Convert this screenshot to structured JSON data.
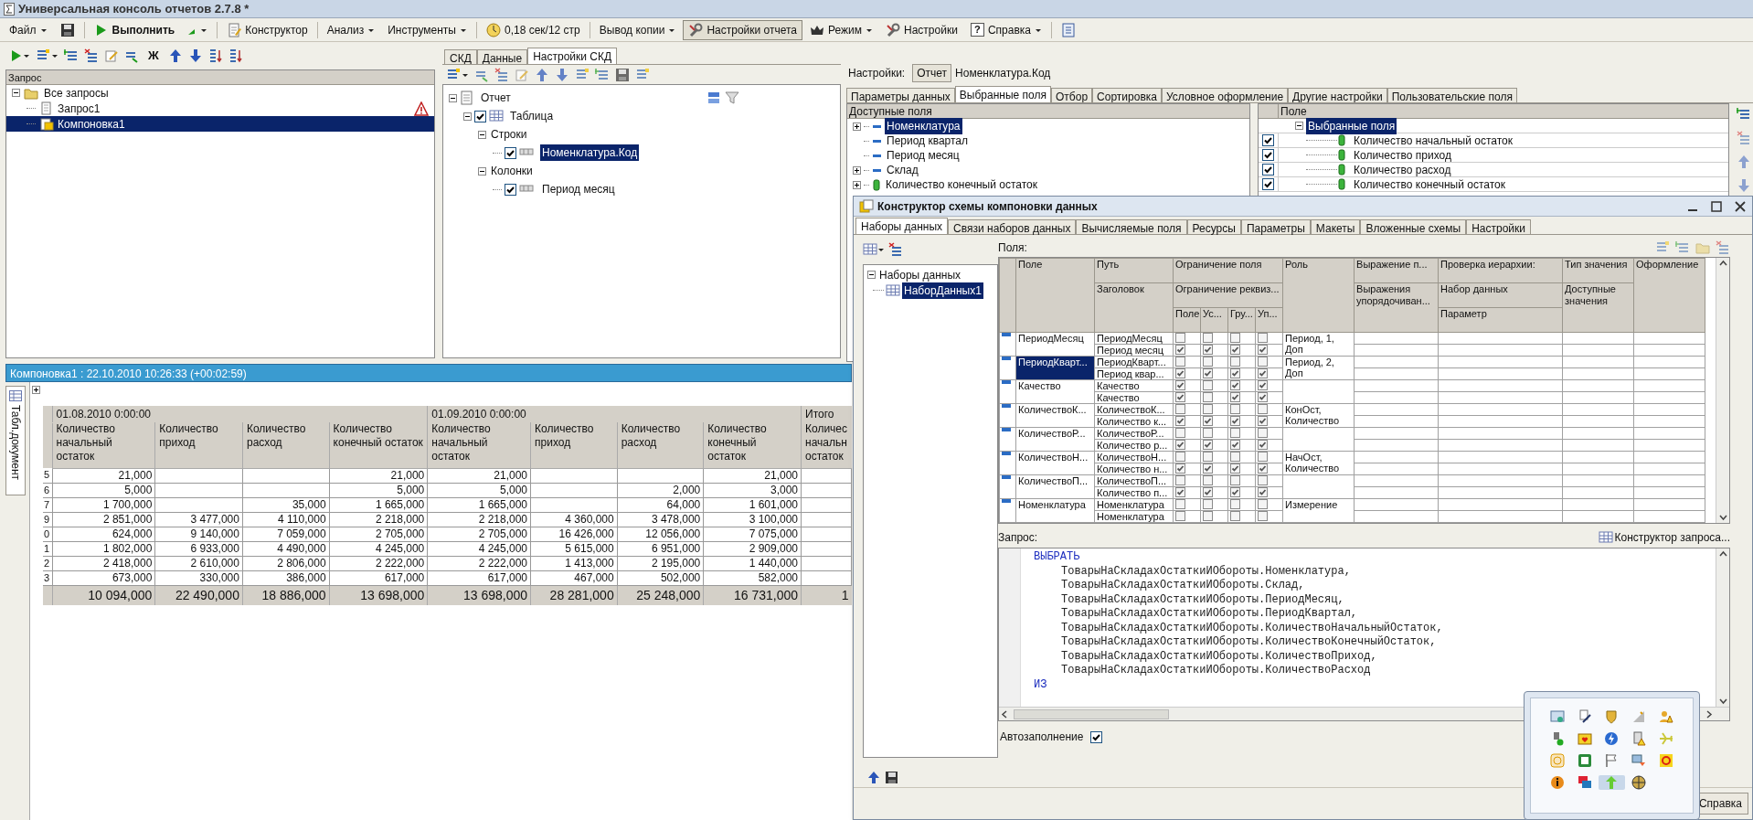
{
  "window": {
    "title": "Универсальная консоль отчетов 2.7.8 *"
  },
  "toolbar": [
    {
      "kind": "menu",
      "label": "Файл",
      "pressed": false
    },
    {
      "kind": "save",
      "pressed": false
    },
    {
      "kind": "run",
      "label": "Выполнить",
      "pressed": false
    },
    {
      "kind": "run_menu",
      "pressed": false
    },
    {
      "kind": "designer",
      "label": "Конструктор",
      "pressed": false
    },
    {
      "kind": "menu",
      "label": "Анализ",
      "pressed": false
    },
    {
      "kind": "menu",
      "label": "Инструменты",
      "pressed": false
    },
    {
      "kind": "timer",
      "label": "0,18 сек/12 стр",
      "pressed": false
    },
    {
      "kind": "menu",
      "label": "Вывод копии",
      "pressed": false
    },
    {
      "kind": "tools",
      "label": "Настройки отчета",
      "pressed": true
    },
    {
      "kind": "mode",
      "label": "Режим",
      "pressed": false
    },
    {
      "kind": "tools",
      "label": "Настройки",
      "pressed": false
    },
    {
      "kind": "help_menu",
      "glyph": "?",
      "label": "Справка",
      "pressed": false
    },
    {
      "kind": "help",
      "pressed": false
    }
  ],
  "query_panel": {
    "bold_button": "Ж",
    "header": "Запрос",
    "tree": [
      {
        "label": "Все запросы",
        "kind": "folder",
        "selected": false,
        "warning": false,
        "children": [
          {
            "label": "Запрос1",
            "kind": "query",
            "selected": false,
            "warning": true
          },
          {
            "label": "Компоновка1",
            "kind": "composition",
            "selected": true,
            "warning": false
          }
        ]
      }
    ]
  },
  "skd_panel": {
    "tabs": [
      {
        "label": "СКД",
        "selected": false
      },
      {
        "label": "Данные",
        "selected": false
      },
      {
        "label": "Настройки СКД",
        "selected": true
      }
    ],
    "tree": [
      {
        "label": "Отчет",
        "kind": "report",
        "selected": false,
        "children": [
          {
            "label": "Таблица",
            "kind": "table",
            "checked": true,
            "selected": false,
            "children": [
              {
                "label": "Строки",
                "kind": "group",
                "selected": false,
                "children": [
                  {
                    "label": "Номенклатура.Код",
                    "kind": "field",
                    "checked": true,
                    "selected": true
                  }
                ]
              },
              {
                "label": "Колонки",
                "kind": "group",
                "selected": false,
                "children": [
                  {
                    "label": "Период месяц",
                    "kind": "field",
                    "checked": true,
                    "selected": false
                  }
                ]
              }
            ]
          }
        ]
      }
    ]
  },
  "settings": {
    "label": "Настройки:",
    "button": "Отчет",
    "current": "Номенклатура.Код",
    "tabs": [
      {
        "label": "Параметры данных",
        "selected": false
      },
      {
        "label": "Выбранные поля",
        "selected": true
      },
      {
        "label": "Отбор",
        "selected": false
      },
      {
        "label": "Сортировка",
        "selected": false
      },
      {
        "label": "Условное оформление",
        "selected": false
      },
      {
        "label": "Другие настройки",
        "selected": false
      },
      {
        "label": "Пользовательские поля",
        "selected": false
      }
    ],
    "available": {
      "header": "Доступные поля",
      "items": [
        {
          "label": "Номенклатура",
          "kind": "dimension",
          "expandable": true,
          "selected": true
        },
        {
          "label": "Период квартал",
          "kind": "dimension",
          "expandable": false,
          "selected": false
        },
        {
          "label": "Период месяц",
          "kind": "dimension",
          "expandable": false,
          "selected": false
        },
        {
          "label": "Склад",
          "kind": "dimension",
          "expandable": true,
          "selected": false
        },
        {
          "label": "Количество конечный остаток",
          "kind": "resource",
          "expandable": true,
          "selected": false
        }
      ]
    },
    "chosen": {
      "header": "Поле",
      "root": "Выбранные поля",
      "items": [
        {
          "label": "Количество начальный остаток",
          "checked": true
        },
        {
          "label": "Количество приход",
          "checked": true
        },
        {
          "label": "Количество расход",
          "checked": true
        },
        {
          "label": "Количество конечный остаток",
          "checked": true
        }
      ]
    }
  },
  "report": {
    "title": "Компоновка1 : 22.10.2010 10:26:33 (+00:02:59)",
    "side_tab": "Табл.документ",
    "groups": [
      {
        "label": "01.08.2010 0:00:00",
        "columns": [
          "Количество начальный остаток",
          "Количество приход",
          "Количество расход",
          "Количество конечный остаток"
        ]
      },
      {
        "label": "01.09.2010 0:00:00",
        "columns": [
          "Количество начальный остаток",
          "Количество приход",
          "Количество расход",
          "Количество конечный остаток"
        ]
      },
      {
        "label": "Итого",
        "columns": [
          "Количес начальн остаток"
        ]
      }
    ],
    "rows": [
      {
        "key": "5",
        "cells": [
          "21,000",
          null,
          null,
          "21,000",
          "21,000",
          null,
          null,
          "21,000",
          null
        ]
      },
      {
        "key": "6",
        "cells": [
          "5,000",
          null,
          null,
          "5,000",
          "5,000",
          null,
          "2,000",
          "3,000",
          null
        ]
      },
      {
        "key": "7",
        "cells": [
          "1 700,000",
          null,
          "35,000",
          "1 665,000",
          "1 665,000",
          null,
          "64,000",
          "1 601,000",
          null
        ]
      },
      {
        "key": "9",
        "cells": [
          "2 851,000",
          "3 477,000",
          "4 110,000",
          "2 218,000",
          "2 218,000",
          "4 360,000",
          "3 478,000",
          "3 100,000",
          null
        ]
      },
      {
        "key": "0",
        "cells": [
          "624,000",
          "9 140,000",
          "7 059,000",
          "2 705,000",
          "2 705,000",
          "16 426,000",
          "12 056,000",
          "7 075,000",
          null
        ]
      },
      {
        "key": "1",
        "cells": [
          "1 802,000",
          "6 933,000",
          "4 490,000",
          "4 245,000",
          "4 245,000",
          "5 615,000",
          "6 951,000",
          "2 909,000",
          null
        ]
      },
      {
        "key": "2",
        "cells": [
          "2 418,000",
          "2 610,000",
          "2 806,000",
          "2 222,000",
          "2 222,000",
          "1 413,000",
          "2 195,000",
          "1 440,000",
          null
        ]
      },
      {
        "key": "3",
        "cells": [
          "673,000",
          "330,000",
          "386,000",
          "617,000",
          "617,000",
          "467,000",
          "502,000",
          "582,000",
          null
        ]
      }
    ],
    "total": [
      "10 094,000",
      "22 490,000",
      "18 886,000",
      "13 698,000",
      "13 698,000",
      "28 281,000",
      "25 248,000",
      "16 731,000",
      "1"
    ]
  },
  "constructor": {
    "title": "Конструктор схемы компоновки данных",
    "tabs": [
      {
        "label": "Наборы данных",
        "selected": true
      },
      {
        "label": "Связи наборов данных",
        "selected": false
      },
      {
        "label": "Вычисляемые поля",
        "selected": false
      },
      {
        "label": "Ресурсы",
        "selected": false
      },
      {
        "label": "Параметры",
        "selected": false
      },
      {
        "label": "Макеты",
        "selected": false
      },
      {
        "label": "Вложенные схемы",
        "selected": false
      },
      {
        "label": "Настройки",
        "selected": false
      }
    ],
    "datasets": [
      {
        "label": "Наборы данных",
        "selected": false,
        "children": [
          {
            "label": "НаборДанных1",
            "selected": true
          }
        ]
      }
    ],
    "fields_label": "Поля:",
    "header": {
      "field": "Поле",
      "path": "Путь",
      "title": "Заголовок",
      "restriction": "Ограничение поля",
      "restriction_attr": "Ограничение реквиз...",
      "restriction_cols": [
        "Поле",
        "Ус...",
        "Гру...",
        "Уп..."
      ],
      "role": "Роль",
      "order": "Выражение п...",
      "order_exprs": "Выражения упорядочиван...",
      "hierarchy": "Проверка иерархии:",
      "hierarchy_dataset": "Набор данных",
      "hierarchy_param": "Параметр",
      "value_type": "Тип значения",
      "available_values": "Доступные значения",
      "appearance": "Оформление"
    },
    "rows": [
      {
        "field": "ПериодМесяц",
        "selected": false,
        "path": "ПериодМесяц",
        "title": "Период месяц",
        "restrict_field": [
          false,
          false,
          false,
          false
        ],
        "restrict_attr": [
          true,
          true,
          true,
          true
        ],
        "role": "Период, 1, Доп"
      },
      {
        "field": "ПериодКварт...",
        "selected": true,
        "path": "ПериодКварт...",
        "title": "Период квар...",
        "restrict_field": [
          false,
          false,
          false,
          false
        ],
        "restrict_attr": [
          true,
          true,
          true,
          true
        ],
        "role": "Период, 2, Доп"
      },
      {
        "field": "Качество",
        "selected": false,
        "path": "Качество",
        "title": "Качество",
        "restrict_field": [
          true,
          false,
          true,
          true
        ],
        "restrict_attr": [
          true,
          false,
          true,
          true
        ]
      },
      {
        "field": "КоличествоК...",
        "selected": false,
        "path": "КоличествоК...",
        "title": "Количество к...",
        "restrict_field": [
          false,
          false,
          false,
          false
        ],
        "restrict_attr": [
          true,
          true,
          true,
          true
        ],
        "role": "КонОст, Количество"
      },
      {
        "field": "КоличествоР...",
        "selected": false,
        "path": "КоличествоР...",
        "title": "Количество р...",
        "restrict_field": [
          false,
          false,
          false,
          false
        ],
        "restrict_attr": [
          true,
          true,
          true,
          true
        ]
      },
      {
        "field": "КоличествоН...",
        "selected": false,
        "path": "КоличествоН...",
        "title": "Количество н...",
        "restrict_field": [
          false,
          false,
          false,
          false
        ],
        "restrict_attr": [
          true,
          true,
          true,
          true
        ],
        "role": "НачОст, Количество"
      },
      {
        "field": "КоличествоП...",
        "selected": false,
        "path": "КоличествоП...",
        "title": "Количество п...",
        "restrict_field": [
          false,
          false,
          false,
          false
        ],
        "restrict_attr": [
          true,
          true,
          true,
          true
        ]
      },
      {
        "field": "Номенклатура",
        "selected": false,
        "path": "Номенклатура",
        "title": "Номенклатура",
        "restrict_field": [
          false,
          false,
          false,
          false
        ],
        "restrict_attr": [
          false,
          false,
          false,
          false
        ],
        "role": "Измерение"
      }
    ],
    "query_label": "Запрос:",
    "query_builder": "Конструктор запроса...",
    "query": [
      {
        "kind": "keyword",
        "text": "ВЫБРАТЬ"
      },
      {
        "kind": "field",
        "text": "ТоварыНаСкладахОстаткиИОбороты.Номенклатура,"
      },
      {
        "kind": "field",
        "text": "ТоварыНаСкладахОстаткиИОбороты.Склад,"
      },
      {
        "kind": "field",
        "text": "ТоварыНаСкладахОстаткиИОбороты.ПериодМесяц,"
      },
      {
        "kind": "field",
        "text": "ТоварыНаСкладахОстаткиИОбороты.ПериодКвартал,"
      },
      {
        "kind": "field",
        "text": "ТоварыНаСкладахОстаткиИОбороты.КоличествоНачальныйОстаток,"
      },
      {
        "kind": "field",
        "text": "ТоварыНаСкладахОстаткиИОбороты.КоличествоКонечныйОстаток,"
      },
      {
        "kind": "field",
        "text": "ТоварыНаСкладахОстаткиИОбороты.КоличествоПриход,"
      },
      {
        "kind": "field",
        "text": "ТоварыНаСкладахОстаткиИОбороты.КоличествоРасход"
      },
      {
        "kind": "keyword",
        "text": "ИЗ"
      }
    ],
    "autofill": {
      "label": "Автозаполнение",
      "checked": true
    },
    "help": "Справка"
  }
}
